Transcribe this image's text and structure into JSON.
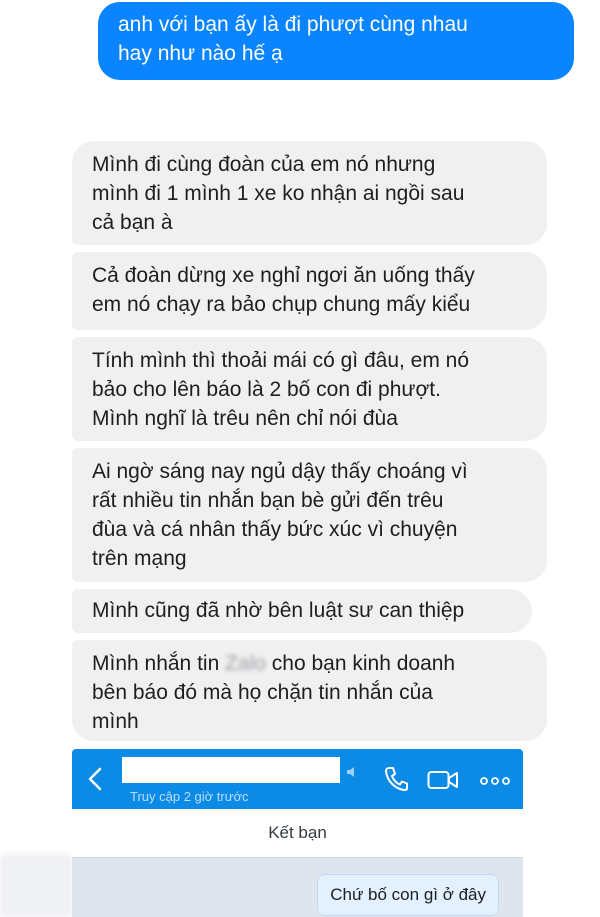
{
  "messages": {
    "sent": "anh với bạn ấy là đi phượt cùng nhau\nhay như nào hế ạ",
    "received": [
      "Mình đi cùng đoàn của em nó nhưng\nmình đi 1 mình 1 xe ko nhận ai ngồi sau\ncả bạn à",
      "Cả đoàn dừng xe nghỉ ngơi ăn uống thấy\nem nó chạy ra bảo chụp chung mấy kiểu",
      "Tính mình thì thoải mái có gì đâu, em nó\nbảo cho lên báo là 2 bố con đi phượt.\nMình nghĩ là trêu nên chỉ nói đùa",
      "Ai ngờ sáng nay ngủ dậy thấy choáng vì\nrất nhiều tin nhắn bạn bè gửi đến trêu\nđùa và cá nhân thấy bức xúc vì chuyện\ntrên mạng",
      "Mình cũng đã nhờ bên luật sư can thiệp"
    ],
    "last_parts": {
      "before": "Mình nhắn tin ",
      "blurred": "Zalo",
      "after": " cho bạn kinh doanh\nbên báo đó mà họ chặn tin nhắn của\nmình"
    }
  },
  "embedded_chat": {
    "status": "Truy cập 2 giờ trước",
    "add_friend": "Kết bạn",
    "message": "Chứ bố con gì ở đây",
    "icons": [
      "back-icon",
      "phone-icon",
      "video-call-icon",
      "more-icon"
    ]
  },
  "colors": {
    "sent_bubble": "#0a84ff",
    "received_bubble": "#f1f0f0",
    "zalo_header": "#0b8ae6"
  }
}
